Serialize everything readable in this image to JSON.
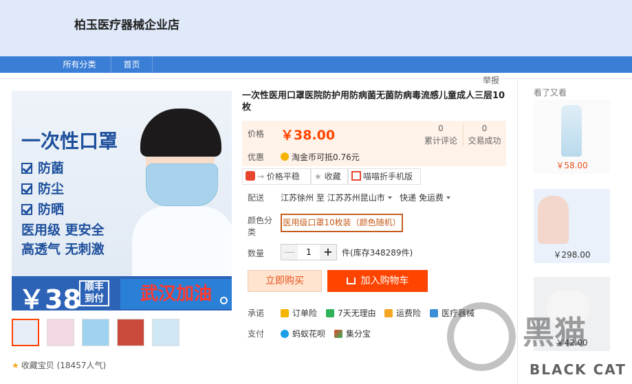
{
  "shop": {
    "name": "柏玉医疗器械企业店"
  },
  "nav": {
    "items": [
      "所有分类",
      "首页"
    ]
  },
  "report_label": "举报",
  "gallery": {
    "headline": "一次性口罩",
    "checks": [
      "防菌",
      "防尘",
      "防晒"
    ],
    "lines": [
      "医用级 更安全",
      "高透气 无刺激"
    ],
    "price": "￥38",
    "shunfeng": "顺丰到付",
    "slogan": "武汉加油",
    "thumb_count": 5
  },
  "favorite": {
    "label": "收藏宝贝",
    "count": "(18457人气)"
  },
  "product": {
    "title": "一次性医用口罩医院防护用防病菌无菌防病毒流感儿童成人三层10枚",
    "price_label": "价格",
    "price": "￥38.00",
    "stats": [
      {
        "value": "0",
        "label": "累计评论"
      },
      {
        "value": "0",
        "label": "交易成功"
      }
    ],
    "promo_label": "优惠",
    "promo_text": "淘金币可抵",
    "promo_value": "0.76元"
  },
  "tools": {
    "price_stable": "价格平稳",
    "favorite": "收藏",
    "mobile": "喵喵折手机版"
  },
  "delivery": {
    "label": "配送",
    "from": "江苏徐州",
    "to_word": "至",
    "to": "江苏苏州昆山市",
    "method": "快递 免运费"
  },
  "color": {
    "label": "颜色分类",
    "option": "医用级口罩10枚装（颜色随机）"
  },
  "quantity": {
    "label": "数量",
    "value": "1",
    "unit": "件(库存348289件)",
    "minus": "—",
    "plus": "+"
  },
  "buttons": {
    "buy": "立即购买",
    "cart": "加入购物车"
  },
  "promises": {
    "label": "承诺",
    "items": [
      "订单险",
      "7天无理由",
      "运费险",
      "医疗器械"
    ]
  },
  "payment": {
    "label": "支付",
    "items": [
      "蚂蚁花呗",
      "集分宝"
    ]
  },
  "recommend": {
    "title": "看了又看",
    "items": [
      {
        "price": "￥58.00"
      },
      {
        "price": "￥298.00"
      },
      {
        "price": "￥42.00"
      }
    ]
  },
  "watermark": {
    "cn": "黑猫",
    "en": "BLACK CAT"
  },
  "colors": {
    "accent": "#ff4400",
    "nav": "#3b7ed6",
    "header_bg": "#dfe9f9",
    "price_bg": "#fff2e8"
  }
}
